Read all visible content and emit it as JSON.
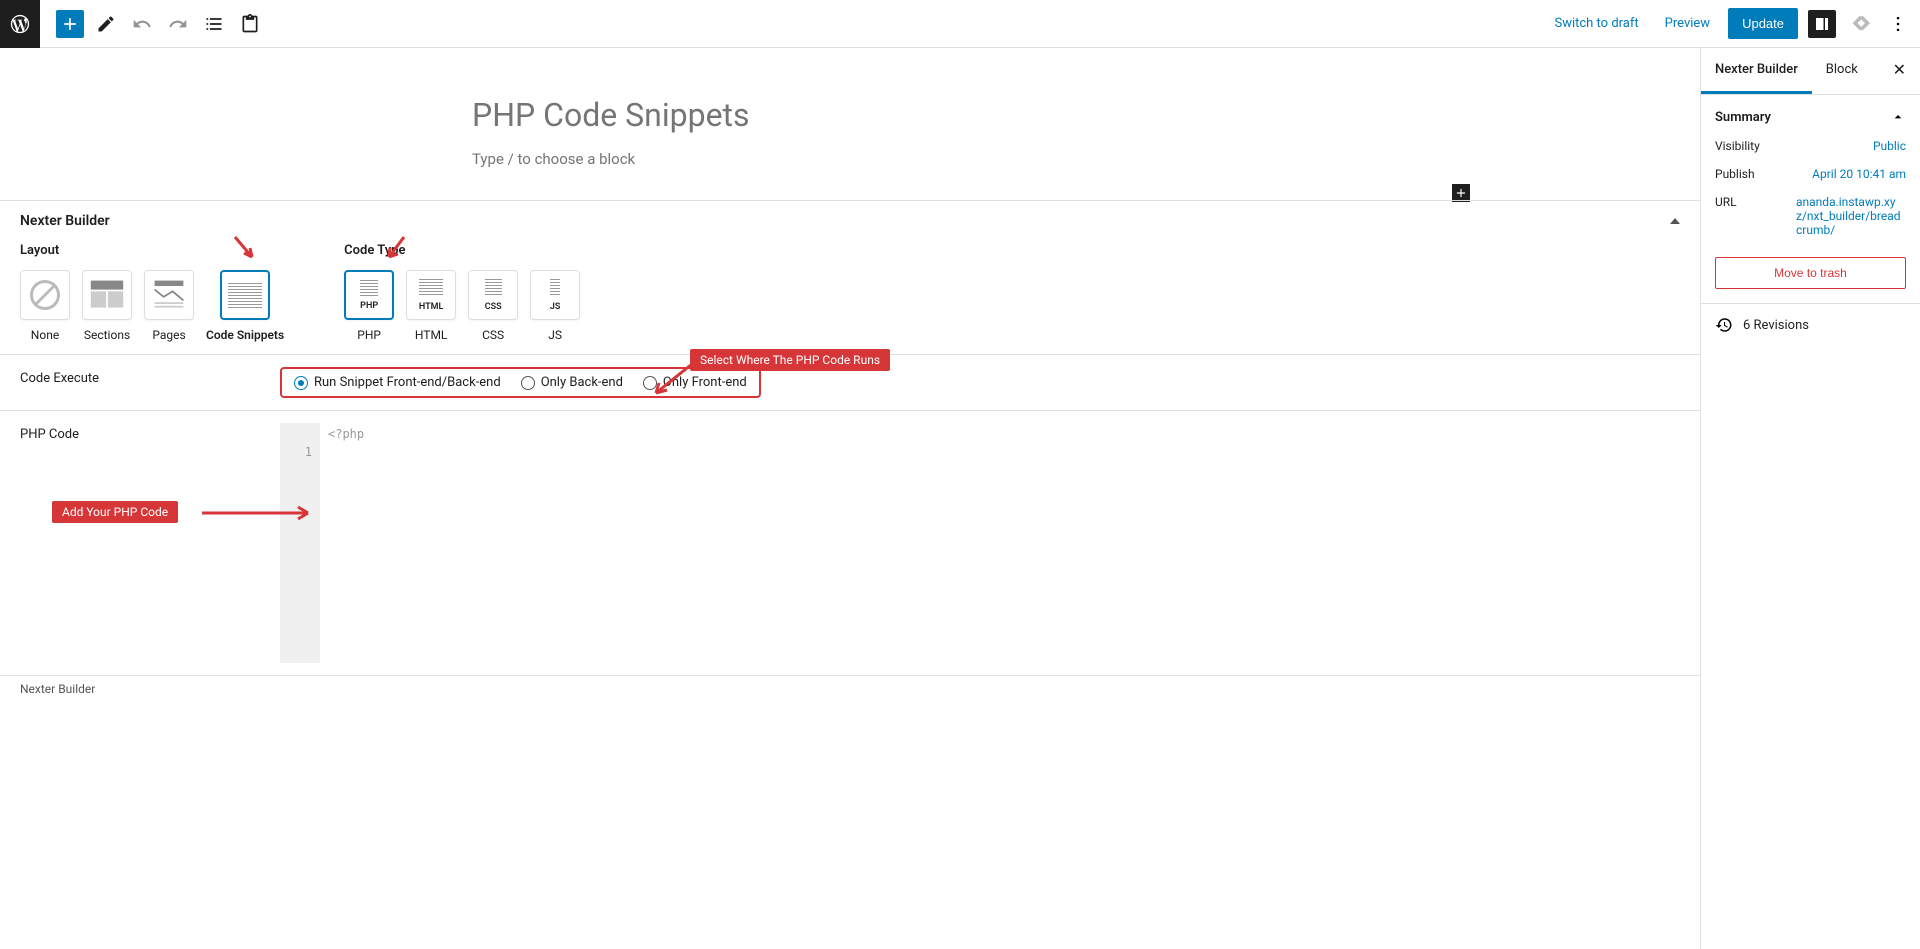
{
  "toolbar": {
    "switch_draft": "Switch to draft",
    "preview": "Preview",
    "update": "Update"
  },
  "editor": {
    "title": "PHP Code Snippets",
    "block_prompt": "Type / to choose a block"
  },
  "nexter": {
    "section_title": "Nexter Builder",
    "layout_label": "Layout",
    "code_type_label": "Code Type",
    "layout_options": [
      {
        "label": "None"
      },
      {
        "label": "Sections"
      },
      {
        "label": "Pages"
      },
      {
        "label": "Code Snippets"
      }
    ],
    "code_type_options": [
      {
        "thumb": "PHP",
        "label": "PHP"
      },
      {
        "thumb": "HTML",
        "label": "HTML"
      },
      {
        "thumb": "CSS",
        "label": "CSS"
      },
      {
        "thumb": "JS",
        "label": "JS"
      }
    ],
    "code_execute_label": "Code Execute",
    "radio_options": [
      {
        "label": "Run Snippet Front-end/Back-end",
        "checked": true
      },
      {
        "label": "Only Back-end",
        "checked": false
      },
      {
        "label": "Only Front-end",
        "checked": false
      }
    ],
    "php_code_label": "PHP Code",
    "code_placeholder": "<?php",
    "line_number": "1"
  },
  "footer": {
    "breadcrumb": "Nexter Builder"
  },
  "sidebar": {
    "tabs": {
      "nexter": "Nexter Builder",
      "block": "Block"
    },
    "summary_label": "Summary",
    "visibility_label": "Visibility",
    "visibility_value": "Public",
    "publish_label": "Publish",
    "publish_value": "April 20 10:41 am",
    "url_label": "URL",
    "url_value": "ananda.instawp.xyz/nxt_builder/breadcrumb/",
    "trash_label": "Move to trash",
    "revisions_label": "6 Revisions"
  },
  "annotations": {
    "select_where": "Select Where The PHP Code Runs",
    "add_code": "Add Your PHP Code"
  }
}
